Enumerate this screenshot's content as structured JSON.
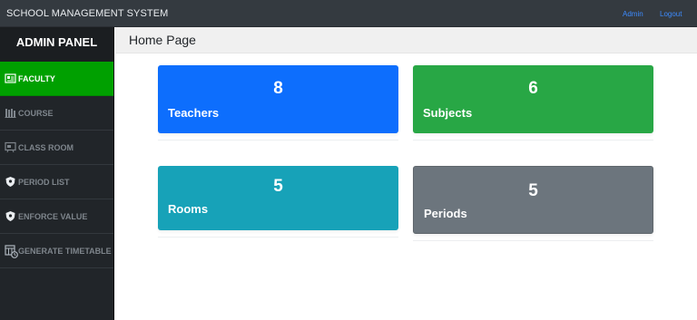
{
  "topbar": {
    "brand": "SCHOOL MANAGEMENT SYSTEM",
    "admin_link": "Admin",
    "logout_link": "Logout"
  },
  "sidebar": {
    "title": "ADMIN PANEL",
    "items": [
      {
        "label": "FACULTY",
        "icon": "faculty-icon",
        "active": true
      },
      {
        "label": "COURSE",
        "icon": "books-icon",
        "active": false
      },
      {
        "label": "CLASS ROOM",
        "icon": "classroom-icon",
        "active": false
      },
      {
        "label": "PERIOD LIST",
        "icon": "shield-icon",
        "active": false
      },
      {
        "label": "ENFORCE VALUE",
        "icon": "shield-icon",
        "active": false
      },
      {
        "label": "GENERATE TIMETABLE",
        "icon": "timetable-icon",
        "active": false
      }
    ]
  },
  "page": {
    "title": "Home Page"
  },
  "cards": {
    "teachers": {
      "count": "8",
      "label": "Teachers",
      "color": "#0d6efd"
    },
    "subjects": {
      "count": "6",
      "label": "Subjects",
      "color": "#28a745"
    },
    "rooms": {
      "count": "5",
      "label": "Rooms",
      "color": "#17a2b8"
    },
    "periods": {
      "count": "5",
      "label": "Periods",
      "color": "#6c757d"
    }
  },
  "colors": {
    "topbar": "#343a40",
    "sidebar": "#212529",
    "active_item": "#00a000",
    "link": "#3d8bfd"
  }
}
